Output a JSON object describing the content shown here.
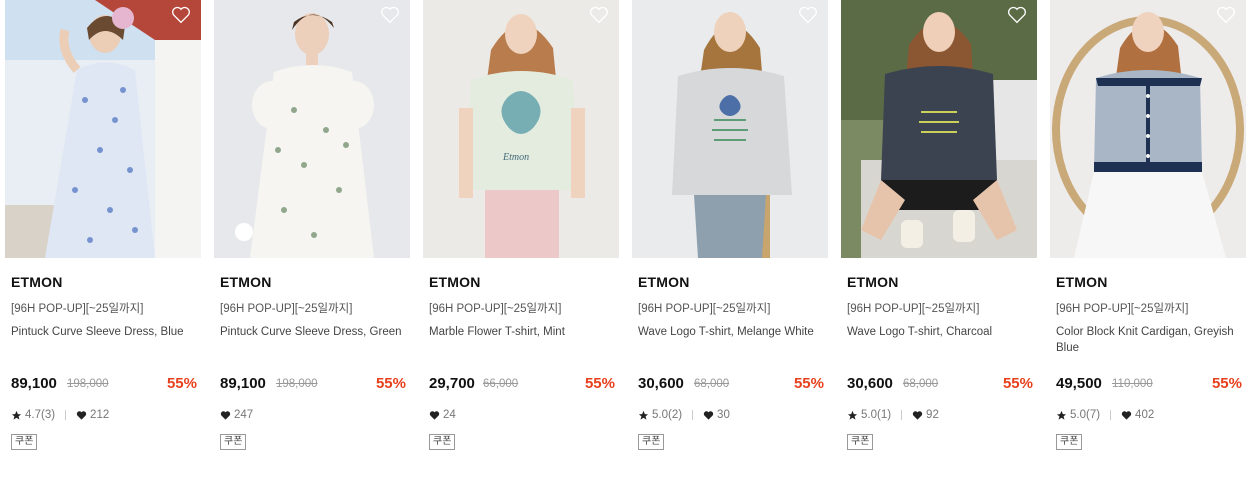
{
  "products": [
    {
      "brand": "ETMON",
      "promo": "[96H POP-UP][~25일까지]",
      "name": "Pintuck Curve Sleeve Dress, Blue",
      "price": "89,100",
      "original_price": "198,000",
      "discount": "55%",
      "rating": "4.7(3)",
      "likes": "212",
      "coupon": "쿠폰",
      "has_rating": true
    },
    {
      "brand": "ETMON",
      "promo": "[96H POP-UP][~25일까지]",
      "name": "Pintuck Curve Sleeve Dress, Green",
      "price": "89,100",
      "original_price": "198,000",
      "discount": "55%",
      "rating": "",
      "likes": "247",
      "coupon": "쿠폰",
      "has_rating": false
    },
    {
      "brand": "ETMON",
      "promo": "[96H POP-UP][~25일까지]",
      "name": "Marble Flower T-shirt, Mint",
      "price": "29,700",
      "original_price": "66,000",
      "discount": "55%",
      "rating": "",
      "likes": "24",
      "coupon": "쿠폰",
      "has_rating": false
    },
    {
      "brand": "ETMON",
      "promo": "[96H POP-UP][~25일까지]",
      "name": "Wave Logo T-shirt, Melange White",
      "price": "30,600",
      "original_price": "68,000",
      "discount": "55%",
      "rating": "5.0(2)",
      "likes": "30",
      "coupon": "쿠폰",
      "has_rating": true
    },
    {
      "brand": "ETMON",
      "promo": "[96H POP-UP][~25일까지]",
      "name": "Wave Logo T-shirt, Charcoal",
      "price": "30,600",
      "original_price": "68,000",
      "discount": "55%",
      "rating": "5.0(1)",
      "likes": "92",
      "coupon": "쿠폰",
      "has_rating": true
    },
    {
      "brand": "ETMON",
      "promo": "[96H POP-UP][~25일까지]",
      "name": "Color Block Knit Cardigan, Greyish Blue",
      "price": "49,500",
      "original_price": "110,000",
      "discount": "55%",
      "rating": "5.0(7)",
      "likes": "402",
      "coupon": "쿠폰",
      "has_rating": true
    }
  ],
  "colors": {
    "discount": "#e8401c",
    "text": "#222222",
    "muted": "#999999"
  },
  "icons": {
    "wishlist": "heart-outline-icon",
    "rating": "star-icon",
    "likes": "heart-filled-icon"
  }
}
